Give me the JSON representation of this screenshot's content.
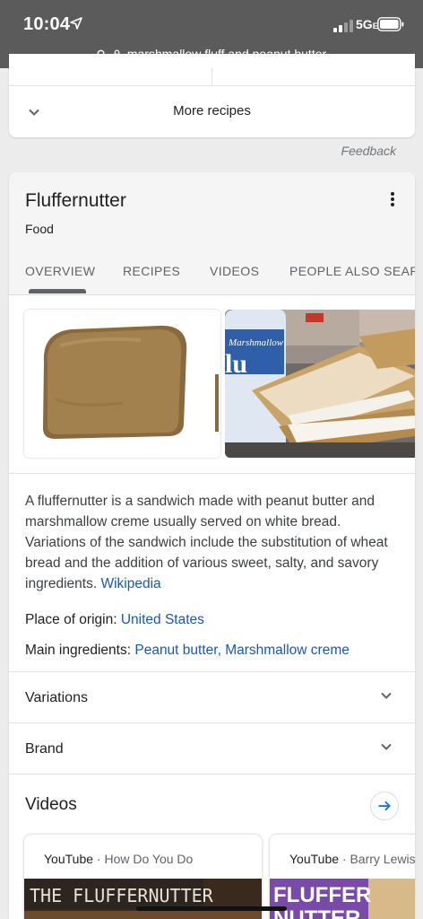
{
  "status_bar": {
    "time": "10:04",
    "network": "5G",
    "network_suffix": "E"
  },
  "url_bar": {
    "query": "marshmallow fluff and peanut butter"
  },
  "recipes_card": {
    "more_label": "More recipes"
  },
  "feedback_label": "Feedback",
  "knowledge_panel": {
    "title": "Fluffernutter",
    "subtitle": "Food",
    "tabs": [
      "OVERVIEW",
      "RECIPES",
      "VIDEOS",
      "PEOPLE ALSO SEAR"
    ],
    "active_tab": "OVERVIEW",
    "images": [
      "image-sandwich-slice",
      "image-marshmallow-sandwich"
    ],
    "image_text": {
      "jar_label": "Marshmallow"
    },
    "description": "A fluffernutter is a sandwich made with peanut butter and marshmallow creme usually served on white bread. Variations of the sandwich include the substitution of wheat bread and the addition of various sweet, salty, and savory ingredients.",
    "description_source": "Wikipedia",
    "facts": {
      "origin_label": "Place of origin:",
      "origin_value": "United States",
      "ingredients_label": "Main ingredients:",
      "ingredient_1": "Peanut butter,",
      "ingredient_2": "Marshmallow creme"
    },
    "expanders": {
      "variations": "Variations",
      "brand": "Brand"
    },
    "videos": {
      "title": "Videos",
      "items": [
        {
          "source": "YouTube",
          "separator": " · ",
          "channel": "How Do You Do",
          "thumb_text": "THE FLUFFERNUTTER"
        },
        {
          "source": "YouTube",
          "separator": " · ",
          "channel": "Barry Lewis",
          "thumb_text": "FLUFFER",
          "thumb_text_2": "NUTTER"
        }
      ]
    }
  },
  "colors": {
    "link": "#1a56b8",
    "topbar": "#5b5b5b",
    "page_bg": "#ececec"
  }
}
